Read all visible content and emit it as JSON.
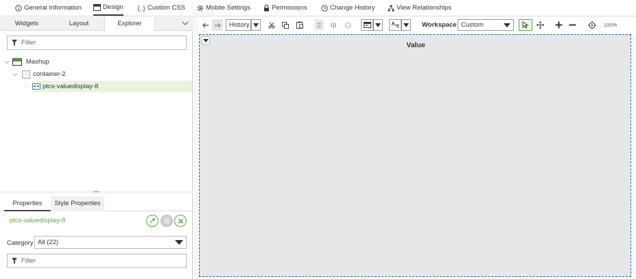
{
  "top_tabs": [
    {
      "label": "General Information",
      "icon": "info-icon"
    },
    {
      "label": "Design",
      "icon": "design-icon",
      "active": true
    },
    {
      "label": "Custom CSS",
      "icon": "css-icon"
    },
    {
      "label": "Mobile Settings",
      "icon": "gear-icon"
    },
    {
      "label": "Permissions",
      "icon": "lock-icon"
    },
    {
      "label": "Change History",
      "icon": "clock-icon"
    },
    {
      "label": "View Relationships",
      "icon": "hierarchy-icon"
    }
  ],
  "left_tabs": [
    {
      "label": "Widgets"
    },
    {
      "label": "Layout"
    },
    {
      "label": "Explorer",
      "active": true
    }
  ],
  "explorer": {
    "filter_placeholder": "Filter",
    "tree": [
      {
        "label": "Mashup",
        "icon": "mashup-icon"
      },
      {
        "label": "container-2",
        "icon": "container-icon"
      },
      {
        "label": "ptcs-valuedisplay-8",
        "icon": "valuedisplay-icon",
        "selected": true
      }
    ]
  },
  "properties": {
    "tabs": [
      {
        "label": "Properties",
        "active": true
      },
      {
        "label": "Style Properties"
      }
    ],
    "widget_name": "ptcs-valuedisplay-8",
    "category_label": "Category",
    "category_value": "All (22)",
    "filter_placeholder": "Filter"
  },
  "toolbar": {
    "history_label": "History",
    "workspace_label": "Workspace",
    "workspace_value": "Custom",
    "zoom": "100%"
  },
  "canvas": {
    "title": "Value"
  },
  "colors": {
    "accent_green": "#5aab3c",
    "selection_bg": "#e8f5dc",
    "canvas_bg": "#e6e7e9",
    "canvas_border": "#1d5f8a"
  }
}
